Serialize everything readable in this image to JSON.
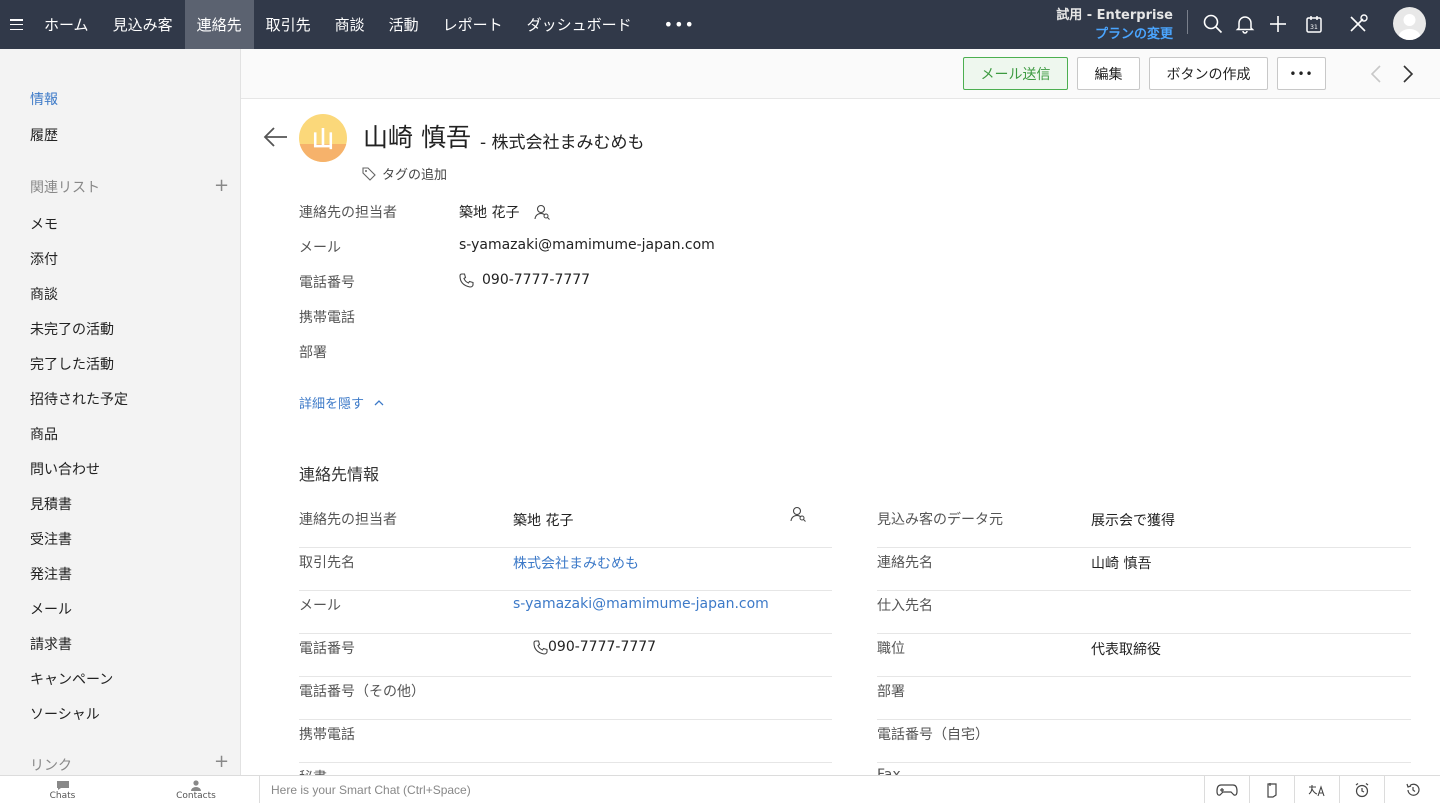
{
  "nav": {
    "tabs": [
      "ホーム",
      "見込み客",
      "連絡先",
      "取引先",
      "商談",
      "活動",
      "レポート",
      "ダッシュボード"
    ],
    "active_tab": "連絡先",
    "more": "•••",
    "trial_label": "試用 - Enterprise",
    "plan_change": "プランの変更"
  },
  "sidebar": {
    "info": "情報",
    "history": "履歴",
    "related_title": "関連リスト",
    "related_items": [
      "メモ",
      "添付",
      "商談",
      "未完了の活動",
      "完了した活動",
      "招待された予定",
      "商品",
      "問い合わせ",
      "見積書",
      "受注書",
      "発注書",
      "メール",
      "請求書",
      "キャンペーン",
      "ソーシャル"
    ],
    "links_title": "リンク",
    "plus": "+"
  },
  "actions": {
    "send_mail": "メール送信",
    "edit": "編集",
    "create_button": "ボタンの作成",
    "more": "•••"
  },
  "contact": {
    "avatar_char": "山",
    "name": "山崎 慎吾",
    "company": "- 株式会社まみむめも",
    "add_tag": "タグの追加"
  },
  "summary": [
    {
      "label": "連絡先の担当者",
      "value": "築地 花子"
    },
    {
      "label": "メール",
      "value": "s-yamazaki@mamimume-japan.com"
    },
    {
      "label": "電話番号",
      "value": "090-7777-7777"
    },
    {
      "label": "携帯電話",
      "value": ""
    },
    {
      "label": "部署",
      "value": ""
    }
  ],
  "hide_details": "詳細を隠す",
  "section_title": "連絡先情報",
  "details_left": [
    {
      "label": "連絡先の担当者",
      "value": "築地 花子"
    },
    {
      "label": "取引先名",
      "value": "株式会社まみむめも"
    },
    {
      "label": "メール",
      "value": "s-yamazaki@mamimume-japan.com"
    },
    {
      "label": "電話番号",
      "value": "090-7777-7777"
    },
    {
      "label": "電話番号（その他）",
      "value": ""
    },
    {
      "label": "携帯電話",
      "value": ""
    },
    {
      "label": "秘書",
      "value": ""
    }
  ],
  "details_right": [
    {
      "label": "見込み客のデータ元",
      "value": "展示会で獲得"
    },
    {
      "label": "連絡先名",
      "value": "山崎 慎吾"
    },
    {
      "label": "仕入先名",
      "value": ""
    },
    {
      "label": "職位",
      "value": "代表取締役"
    },
    {
      "label": "部署",
      "value": ""
    },
    {
      "label": "電話番号（自宅）",
      "value": ""
    },
    {
      "label": "Fax",
      "value": ""
    }
  ],
  "bottom": {
    "chats": "Chats",
    "contacts": "Contacts",
    "chat_placeholder": "Here is your Smart Chat (Ctrl+Space)"
  },
  "colors": {
    "nav_bg": "#313949",
    "active_tab_bg": "#5b6270",
    "link": "#3d7ac8",
    "accent_green": "#4caf50"
  }
}
